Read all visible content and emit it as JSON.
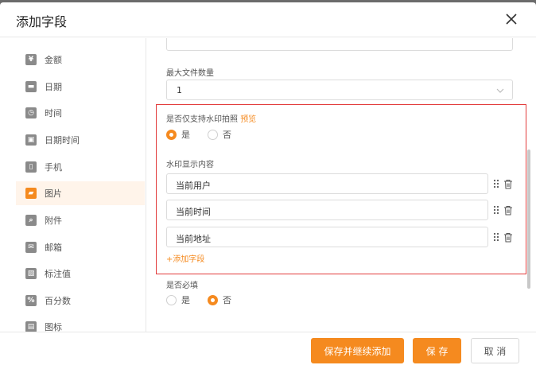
{
  "modal": {
    "title": "添加字段"
  },
  "sidebar": {
    "items": [
      {
        "icon": "currency-icon",
        "glyph": "¥",
        "label": "金额"
      },
      {
        "icon": "date-icon",
        "glyph": "▬",
        "label": "日期"
      },
      {
        "icon": "clock-icon",
        "glyph": "◷",
        "label": "时间"
      },
      {
        "icon": "datetime-icon",
        "glyph": "▣",
        "label": "日期时间"
      },
      {
        "icon": "phone-icon",
        "glyph": "▯",
        "label": "手机"
      },
      {
        "icon": "image-icon",
        "glyph": "▰",
        "label": "图片"
      },
      {
        "icon": "attachment-icon",
        "glyph": "⌕",
        "label": "附件"
      },
      {
        "icon": "email-icon",
        "glyph": "✉",
        "label": "邮箱"
      },
      {
        "icon": "text-value-icon",
        "glyph": "▧",
        "label": "标注值"
      },
      {
        "icon": "percent-icon",
        "glyph": "%",
        "label": "百分数"
      },
      {
        "icon": "more-icon",
        "glyph": "▤",
        "label": "图标"
      }
    ],
    "active_index": 5
  },
  "form": {
    "max_files_label": "最大文件数量",
    "max_files_value": "1",
    "watermark_only_label": "是否仅支持水印拍照",
    "preview_label": "预览",
    "yes_label": "是",
    "no_label": "否",
    "watermark_content_label": "水印显示内容",
    "watermark_items": [
      "当前用户",
      "当前时间",
      "当前地址"
    ],
    "add_item_label": "+添加字段",
    "required_label": "是否必填"
  },
  "footer": {
    "save_continue_label": "保存并继续添加",
    "save_label": "保 存",
    "cancel_label": "取 消"
  },
  "colors": {
    "accent": "#f58a1f",
    "highlight_border": "#e23b3b"
  }
}
